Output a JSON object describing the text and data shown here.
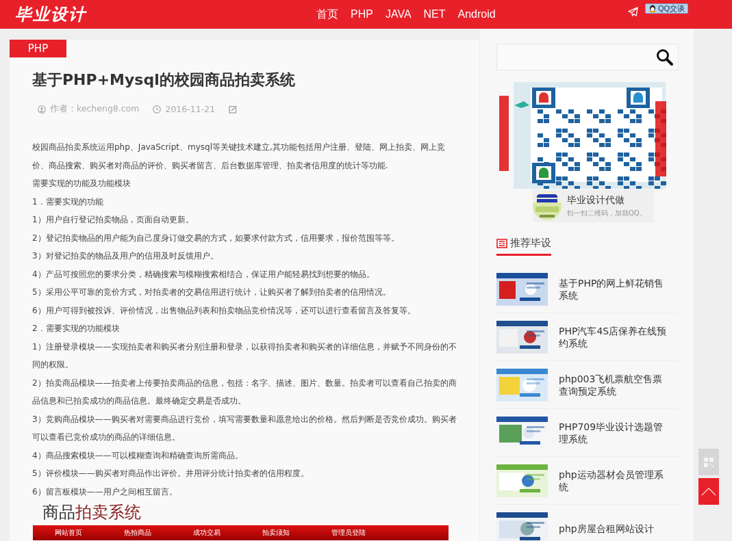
{
  "header": {
    "logo": "毕业设计",
    "nav": [
      "首页",
      "PHP",
      "JAVA",
      "NET",
      "Android"
    ],
    "qq_button": "QQ交谈"
  },
  "article": {
    "category": "PHP",
    "title": "基于PHP+Mysql的校园商品拍卖系统",
    "author": "作者：kecheng8.com",
    "date": "2016-11-21",
    "paragraphs": [
      "校园商品拍卖系统运用php、JavaScript、mysql等关键技术建立,其功能包括用户注册、登陆、网上拍卖、网上竞价、商品搜索、购买者对商品的评价、购买者留言、后台数据库管理、拍卖者信用度的统计等功能.",
      "需要实现的功能及功能模块",
      "1．需要实现的功能",
      "1）用户自行登记拍卖物品，页面自动更新。",
      "2）登记拍卖物品的用户能为自己度身订做交易的方式，如要求付款方式，信用要求，报价范围等等。",
      "3）对登记拍卖的物品及用户的信用及时反馈用户。",
      "4）产品可按照您的要求分类，精确搜索与模糊搜索相结合，保证用户能轻易找到想要的物品。",
      "5）采用公平可靠的竞价方式，对拍卖者的交易信用进行统计，让购买者了解到拍卖者的信用情况。",
      "6）用户可得到被投诉、评价情况，出售物品列表和拍卖物品竞价情况等，还可以进行查看留言及答复等。",
      "2．需要实现的功能模块",
      "1）注册登录模块——实现拍卖者和购买者分别注册和登录，以获得拍卖者和购买者的详细信息，并赋予不同身份的不同的权限。",
      "2）拍卖商品模块——拍卖者上传要拍卖商品的信息，包括：名字、描述、图片、数量。拍卖者可以查看自己拍卖的商品信息和已拍卖成功的商品信息。最终确定交易是否成功。",
      "3）竞购商品模块——购买者对需要商品进行竞价，填写需要数量和愿意给出的价格。然后判断是否竞价成功。购买者可以查看已竞价成功的商品的详细信息。",
      "4）商品搜索模块——可以模糊查询和精确查询所需商品。",
      "5）评价模块——购买者对商品作出评价。并用评分统计拍卖者的信用程度。",
      "6）留言板模块——用户之间相互留言。"
    ],
    "screenshot": {
      "title": "商品",
      "title_accent": "拍卖系统",
      "nav": [
        "网站首页",
        "热拍商品",
        "成功交易",
        "拍卖须知",
        "管理员登陆"
      ]
    }
  },
  "sidebar": {
    "qr_card": {
      "title": "毕业设计代做",
      "subtitle": "扫一扫二维码，加我QQ。"
    },
    "section_title": "推荐毕设",
    "items": [
      {
        "title": "基于PHP的网上鲜花销售系统",
        "kind": "picture"
      },
      {
        "title": "PHP汽车4S店保养在线预约系统",
        "kind": "picture"
      },
      {
        "title": "php003飞机票航空售票查询预定系统",
        "kind": "picture"
      },
      {
        "title": "PHP709毕业设计选题管理系统",
        "kind": "picture"
      },
      {
        "title": "php运动器材会员管理系统",
        "kind": "picture"
      },
      {
        "title": "php房屋合租网站设计",
        "kind": "picture"
      }
    ]
  }
}
